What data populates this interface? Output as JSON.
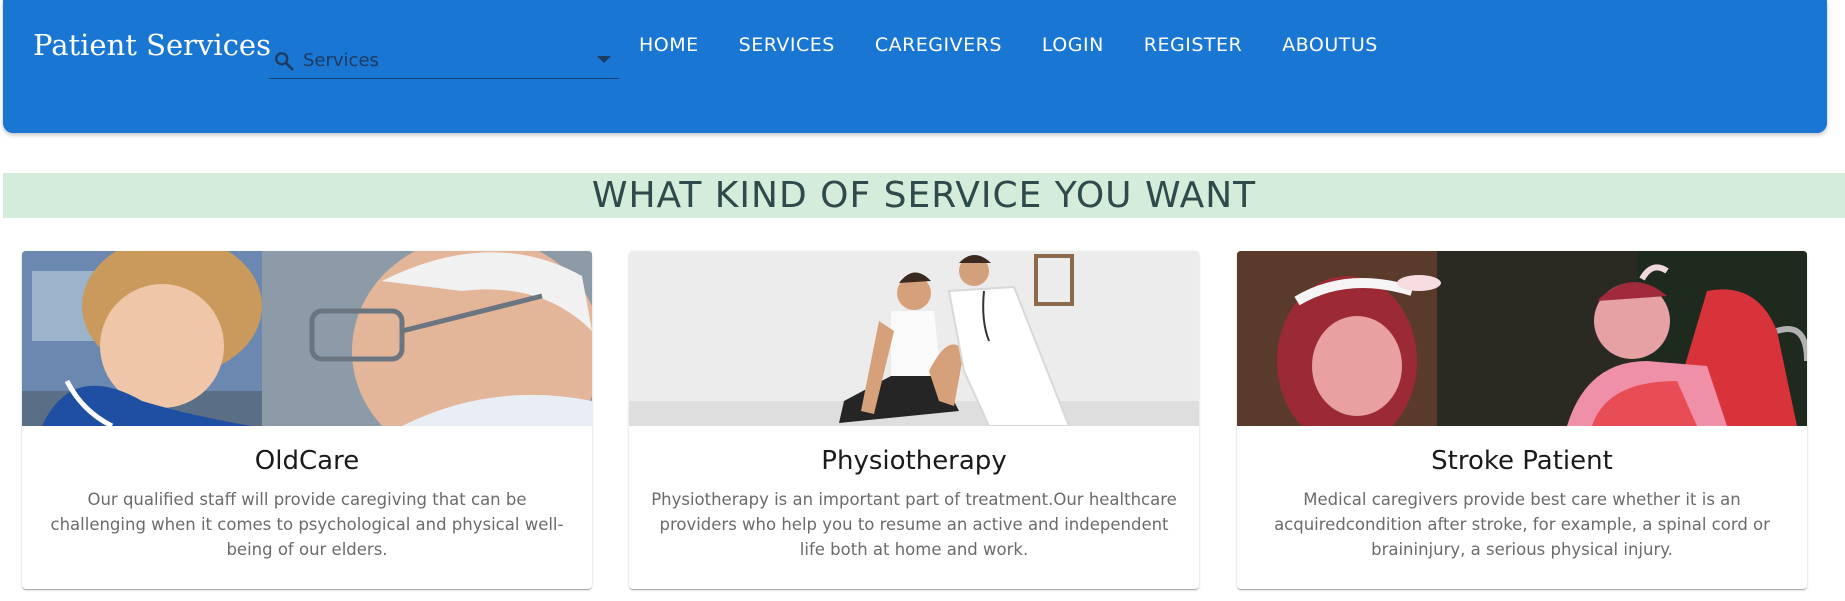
{
  "header": {
    "brand": "Patient Services",
    "search": {
      "placeholder": "Services",
      "icon": "search-icon"
    },
    "nav": [
      "HOME",
      "SERVICES",
      "CAREGIVERS",
      "LOGIN",
      "REGISTER",
      "ABOUTUS"
    ]
  },
  "banner": {
    "heading": "WHAT KIND OF SERVICE YOU WANT"
  },
  "cards": [
    {
      "title": "OldCare",
      "description": "Our qualified staff will provide caregiving that can be challenging when it comes to psychological and physical well-being of our elders."
    },
    {
      "title": "Physiotherapy",
      "description": "Physiotherapy is an important part of treatment.Our healthcare providers who help you to resume an active and independent life both at home and work."
    },
    {
      "title": "Stroke Patient",
      "description": "Medical caregivers provide best care whether it is an acquiredcondition after stroke, for example, a spinal cord or braininjury, a serious physical injury."
    }
  ],
  "colors": {
    "appbar": "#1976d2",
    "banner": "#d4eddb",
    "heading": "#2e4a4a"
  }
}
